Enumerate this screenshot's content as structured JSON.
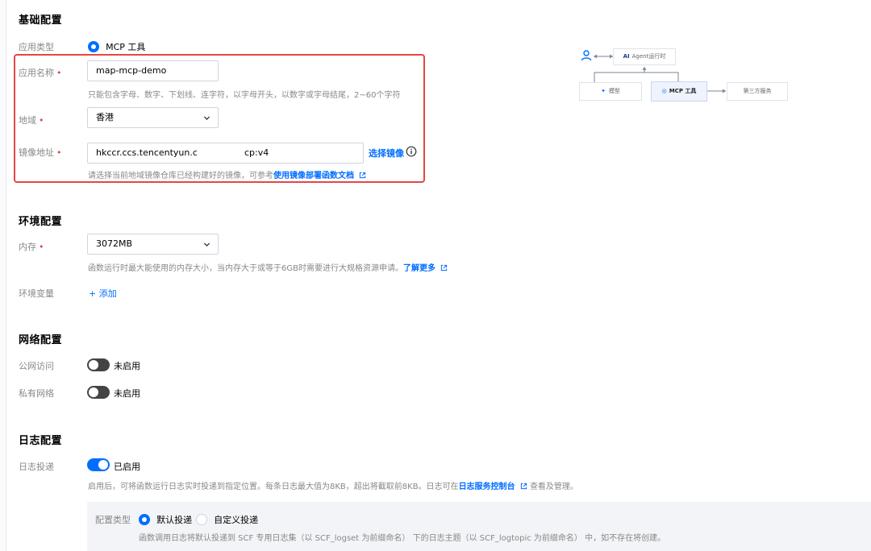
{
  "basic": {
    "title": "基础配置",
    "app_type": {
      "label": "应用类型",
      "option": "MCP 工具"
    },
    "app_name": {
      "label": "应用名称",
      "value": "map-mcp-demo",
      "hint": "只能包含字母、数字、下划线、连字符，以字母开头，以数字或字母结尾，2~60个字符"
    },
    "region": {
      "label": "地域",
      "value": "香港"
    },
    "image": {
      "label": "镜像地址",
      "value_left": "hkccr.ccs.tencentyun.c",
      "value_right": "cp:v4",
      "select_label": "选择镜像",
      "hint": "请选择当前地域镜像仓库已经构建好的镜像，可参考",
      "doc_link": "使用镜像部署函数文档"
    }
  },
  "diagram": {
    "agent": "Agent运行时",
    "model": "模型",
    "mcp": "MCP 工具",
    "third_party": "第三方服务"
  },
  "env": {
    "title": "环境配置",
    "memory": {
      "label": "内存",
      "value": "3072MB",
      "hint": "函数运行时最大能使用的内存大小，当内存大于或等于6GB时需要进行大规格资源申请。",
      "link": "了解更多"
    },
    "env_vars": {
      "label": "环境变量",
      "add_label": "+ 添加"
    }
  },
  "network": {
    "title": "网络配置",
    "public": {
      "label": "公网访问",
      "status": "未启用"
    },
    "private": {
      "label": "私有网络",
      "status": "未启用"
    }
  },
  "log": {
    "title": "日志配置",
    "delivery": {
      "label": "日志投递",
      "status": "已启用"
    },
    "hint_before": "启用后，可将函数运行日志实时投递到指定位置。每条日志最大值为8KB，超出将截取前8KB。日志可在",
    "console_link": "日志服务控制台",
    "hint_after": "查看及管理。",
    "config_type": {
      "label": "配置类型",
      "options": [
        "默认投递",
        "自定义投递"
      ],
      "hint": "函数调用日志将默认投递到 SCF 专用日志集（以 SCF_logset 为前缀命名） 下的日志主题（以 SCF_logtopic 为前缀命名） 中，如不存在将创建。"
    }
  },
  "colors": {
    "accent": "#006eff",
    "required": "#e54545",
    "highlight": "#e54545"
  }
}
